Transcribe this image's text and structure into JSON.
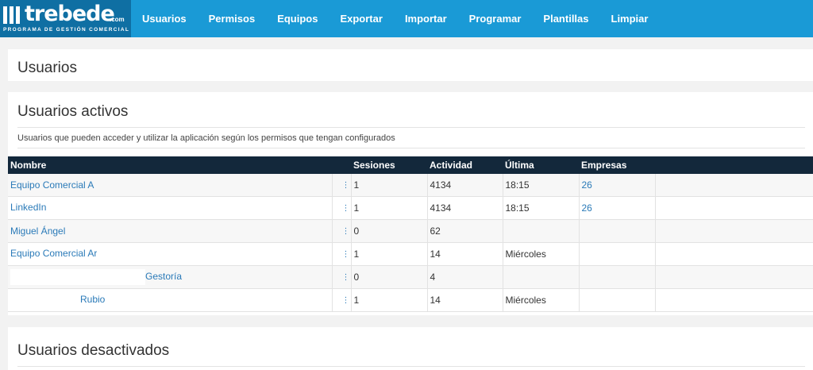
{
  "brand": {
    "name": "trebede",
    "domain_suffix": ".com",
    "tagline": "PROGRAMA DE GESTIÓN COMERCIAL"
  },
  "nav": {
    "items": [
      {
        "label": "Usuarios"
      },
      {
        "label": "Permisos"
      },
      {
        "label": "Equipos"
      },
      {
        "label": "Exportar"
      },
      {
        "label": "Importar"
      },
      {
        "label": "Programar"
      },
      {
        "label": "Plantillas"
      },
      {
        "label": "Limpiar"
      }
    ]
  },
  "page": {
    "title": "Usuarios"
  },
  "active_users": {
    "title": "Usuarios activos",
    "description": "Usuarios que pueden acceder y utilizar la aplicación según los permisos que tengan configurados",
    "columns": {
      "name": "Nombre",
      "sessions": "Sesiones",
      "activity": "Actividad",
      "last": "Última",
      "companies": "Empresas"
    },
    "rows": [
      {
        "name": "Equipo Comercial A",
        "sessions": "1",
        "activity": "4134",
        "last": "18:15",
        "companies": "26"
      },
      {
        "name": "LinkedIn",
        "sessions": "1",
        "activity": "4134",
        "last": "18:15",
        "companies": "26"
      },
      {
        "name": "Miguel Ángel",
        "sessions": "0",
        "activity": "62",
        "last": "",
        "companies": ""
      },
      {
        "name": "Equipo Comercial Ar",
        "sessions": "1",
        "activity": "14",
        "last": "Miércoles",
        "companies": ""
      },
      {
        "name": "Gestoría",
        "sessions": "0",
        "activity": "4",
        "last": "",
        "companies": ""
      },
      {
        "name": "Rubio",
        "sessions": "1",
        "activity": "14",
        "last": "Miércoles",
        "companies": ""
      }
    ]
  },
  "inactive_users": {
    "title": "Usuarios desactivados"
  },
  "icons": {
    "row_menu": "vertical-dots-icon"
  },
  "colors": {
    "nav_bg": "#1a9ad6",
    "logo_bg": "#0f6fa3",
    "table_header_bg": "#13283b",
    "link": "#2a7ab8"
  }
}
